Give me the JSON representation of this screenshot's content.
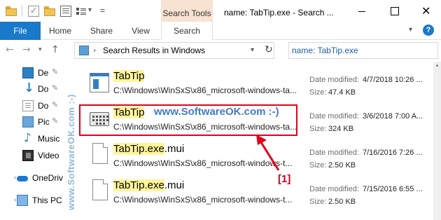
{
  "titlebar": {
    "search_tools_label": "Search Tools",
    "window_title": "name: TabTip.exe - Search ...",
    "close_glyph": "✕"
  },
  "ribbon": {
    "tabs": [
      {
        "label": "File"
      },
      {
        "label": "Home"
      },
      {
        "label": "Share"
      },
      {
        "label": "View"
      },
      {
        "label": "Search"
      }
    ],
    "help_glyph": "?"
  },
  "address": {
    "location": "Search Results in Windows",
    "search_query": "name: TabTip.exe"
  },
  "nav_pane": {
    "items": [
      {
        "label": "De",
        "icon": "desktop-icon"
      },
      {
        "label": "Do",
        "icon": "downloads-icon"
      },
      {
        "label": "Do",
        "icon": "documents-icon"
      },
      {
        "label": "Pic",
        "icon": "pictures-icon"
      },
      {
        "label": "Music",
        "icon": "music-icon"
      },
      {
        "label": "Video",
        "icon": "videos-icon"
      },
      {
        "label": "OneDriv",
        "icon": "onedrive-icon"
      },
      {
        "label": "This PC",
        "icon": "thispc-icon"
      }
    ]
  },
  "files": [
    {
      "name_highlight": "TabTip",
      "name_rest": "",
      "path": "C:\\Windows\\WinSxS\\x86_microsoft-windows-ta...",
      "date_label": "Date modified:",
      "date": "4/7/2018 10:26 ...",
      "size_label": "Size:",
      "size": "47.4 KB"
    },
    {
      "name_highlight": "TabTip",
      "name_rest": "",
      "path": "C:\\Windows\\WinSxS\\x86_microsoft-windows-ta...",
      "date_label": "Date modified:",
      "date": "3/6/2018 7:00 A...",
      "size_label": "Size:",
      "size": "324 KB"
    },
    {
      "name_highlight": "TabTip.exe",
      "name_rest": ".mui",
      "path": "C:\\Windows\\WinSxS\\x86_microsoft-windows-t...",
      "date_label": "Date modified:",
      "date": "7/16/2016 7:26 ...",
      "size_label": "Size:",
      "size": "2.50 KB"
    },
    {
      "name_highlight": "TabTip.exe",
      "name_rest": ".mui",
      "path": "C:\\Windows\\WinSxS\\x86_microsoft-windows-t...",
      "date_label": "Date modified:",
      "date": "7/15/2016 6:55 ...",
      "size_label": "Size:",
      "size": "2.50 KB"
    }
  ],
  "annotations": {
    "watermark_center": "www.SoftwareOK.com :-)",
    "watermark_side": "www.SoftwareOK.com :-)",
    "marker_label": "[1]",
    "accent_color": "#e3001b"
  }
}
